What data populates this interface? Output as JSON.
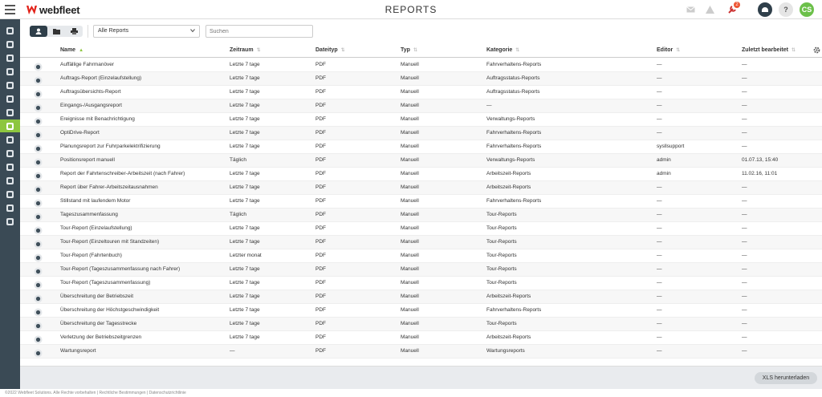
{
  "app": {
    "brand": "webfleet",
    "title": "REPORTS",
    "alert_count": "2",
    "avatar_initials": "CS",
    "help_label": "?"
  },
  "colors": {
    "brand_red": "#e2231a",
    "accent": "#8dc63f",
    "sidebar": "#3a4a55",
    "avatar": "#6cc04a",
    "dark_button": "#2f3f4a",
    "alert_icon": "#e53"
  },
  "topbar_icons": [
    "mail-icon",
    "warning-icon",
    "tools-icon",
    "share-icon",
    "help-icon",
    "avatar"
  ],
  "sidebar": {
    "items": [
      {
        "name": "map-icon",
        "active": false
      },
      {
        "name": "vehicle-icon",
        "active": false
      },
      {
        "name": "driver-icon",
        "active": false
      },
      {
        "name": "orders-icon",
        "active": false
      },
      {
        "name": "alerts-icon",
        "active": false
      },
      {
        "name": "tools-icon",
        "active": false
      },
      {
        "name": "chart-icon",
        "active": false
      },
      {
        "name": "reports-icon",
        "active": true
      },
      {
        "name": "fuel-icon",
        "active": false
      },
      {
        "name": "building-icon",
        "active": false
      },
      {
        "name": "location-icon",
        "active": false
      },
      {
        "name": "user-icon",
        "active": false
      },
      {
        "name": "integration-icon",
        "active": false
      },
      {
        "name": "settings-circle-icon",
        "active": false
      },
      {
        "name": "gear-icon",
        "active": false
      }
    ]
  },
  "toolbar": {
    "views": [
      "user-icon",
      "folder-icon",
      "printer-icon"
    ],
    "active_view": 0,
    "filter_value": "Alle Reports",
    "search_placeholder": "Suchen"
  },
  "table": {
    "columns": [
      "Name",
      "Zeitraum",
      "Dateityp",
      "Typ",
      "Kategorie",
      "Editor",
      "Zuletzt bearbeitet"
    ],
    "sorted_column": 0,
    "rows": [
      {
        "icon": "driving-icon",
        "name": "Auffällige Fahrmanöver",
        "zeitraum": "Letzte 7 tage",
        "dateityp": "PDF",
        "typ": "Manuell",
        "kategorie": "Fahrverhaltens-Reports",
        "editor": "—",
        "zuletzt": "—"
      },
      {
        "icon": "order-icon",
        "name": "Auftrags-Report (Einzelaufstellung)",
        "zeitraum": "Letzte 7 tage",
        "dateityp": "PDF",
        "typ": "Manuell",
        "kategorie": "Auftragsstatus-Reports",
        "editor": "—",
        "zuletzt": "—"
      },
      {
        "icon": "order-icon",
        "name": "Auftragsübersichts-Report",
        "zeitraum": "Letzte 7 tage",
        "dateityp": "PDF",
        "typ": "Manuell",
        "kategorie": "Auftragsstatus-Reports",
        "editor": "—",
        "zuletzt": "—"
      },
      {
        "icon": "inout-icon",
        "name": "Eingangs-/Ausgangsreport",
        "zeitraum": "Letzte 7 tage",
        "dateityp": "PDF",
        "typ": "Manuell",
        "kategorie": "—",
        "editor": "—",
        "zuletzt": "—"
      },
      {
        "icon": "warning-icon",
        "name": "Ereignisse mit Benachrichtigung",
        "zeitraum": "Letzte 7 tage",
        "dateityp": "PDF",
        "typ": "Manuell",
        "kategorie": "Verwaltungs-Reports",
        "editor": "—",
        "zuletzt": "—"
      },
      {
        "icon": "gauge-icon",
        "name": "OptiDrive-Report",
        "zeitraum": "Letzte 7 tage",
        "dateityp": "PDF",
        "typ": "Manuell",
        "kategorie": "Fahrverhaltens-Reports",
        "editor": "—",
        "zuletzt": "—"
      },
      {
        "icon": "steering-icon",
        "name": "Planungsreport zur Fuhrparkelektrifizierung",
        "zeitraum": "Letzte 7 tage",
        "dateityp": "PDF",
        "typ": "Manuell",
        "kategorie": "Fahrverhaltens-Reports",
        "editor": "sysllsupport",
        "zuletzt": "—"
      },
      {
        "icon": "position-icon",
        "name": "Positionsreport manuell",
        "zeitraum": "Täglich",
        "dateityp": "PDF",
        "typ": "Manuell",
        "kategorie": "Verwaltungs-Reports",
        "editor": "admin",
        "zuletzt": "01.07.13, 15:40"
      },
      {
        "icon": "driver-icon",
        "name": "Report der Fahrtenschreiber-Arbeitszeit (nach Fahrer)",
        "zeitraum": "Letzte 7 tage",
        "dateityp": "PDF",
        "typ": "Manuell",
        "kategorie": "Arbeitszeit-Reports",
        "editor": "admin",
        "zuletzt": "11.02.16, 11:01"
      },
      {
        "icon": "exclamation-icon",
        "name": "Report über Fahrer-Arbeitszeitausnahmen",
        "zeitraum": "Letzte 7 tage",
        "dateityp": "PDF",
        "typ": "Manuell",
        "kategorie": "Arbeitszeit-Reports",
        "editor": "—",
        "zuletzt": "—"
      },
      {
        "icon": "exclamation-icon",
        "name": "Stillstand mit laufendem Motor",
        "zeitraum": "Letzte 7 tage",
        "dateityp": "PDF",
        "typ": "Manuell",
        "kategorie": "Fahrverhaltens-Reports",
        "editor": "—",
        "zuletzt": "—"
      },
      {
        "icon": "chart-icon",
        "name": "Tageszusammenfassung",
        "zeitraum": "Täglich",
        "dateityp": "PDF",
        "typ": "Manuell",
        "kategorie": "Tour-Reports",
        "editor": "—",
        "zuletzt": "—"
      },
      {
        "icon": "tour-icon",
        "name": "Tour-Report (Einzelaufstellung)",
        "zeitraum": "Letzte 7 tage",
        "dateityp": "PDF",
        "typ": "Manuell",
        "kategorie": "Tour-Reports",
        "editor": "—",
        "zuletzt": "—"
      },
      {
        "icon": "tour-icon",
        "name": "Tour-Report (Einzeltouren mit Standzeiten)",
        "zeitraum": "Letzte 7 tage",
        "dateityp": "PDF",
        "typ": "Manuell",
        "kategorie": "Tour-Reports",
        "editor": "—",
        "zuletzt": "—"
      },
      {
        "icon": "truck-icon",
        "name": "Tour-Report (Fahrtenbuch)",
        "zeitraum": "Letzter monat",
        "dateityp": "PDF",
        "typ": "Manuell",
        "kategorie": "Tour-Reports",
        "editor": "—",
        "zuletzt": "—"
      },
      {
        "icon": "summary-icon",
        "name": "Tour-Report (Tageszusammenfassung nach Fahrer)",
        "zeitraum": "Letzte 7 tage",
        "dateityp": "PDF",
        "typ": "Manuell",
        "kategorie": "Tour-Reports",
        "editor": "—",
        "zuletzt": "—"
      },
      {
        "icon": "summary-icon",
        "name": "Tour-Report (Tageszusammenfassung)",
        "zeitraum": "Letzte 7 tage",
        "dateityp": "PDF",
        "typ": "Manuell",
        "kategorie": "Tour-Reports",
        "editor": "—",
        "zuletzt": "—"
      },
      {
        "icon": "clock-icon",
        "name": "Überschreitung der Betriebszeit",
        "zeitraum": "Letzte 7 tage",
        "dateityp": "PDF",
        "typ": "Manuell",
        "kategorie": "Arbeitszeit-Reports",
        "editor": "—",
        "zuletzt": "—"
      },
      {
        "icon": "speed-icon",
        "name": "Überschreitung der Höchstgeschwindigkeit",
        "zeitraum": "Letzte 7 tage",
        "dateityp": "PDF",
        "typ": "Manuell",
        "kategorie": "Fahrverhaltens-Reports",
        "editor": "—",
        "zuletzt": "—"
      },
      {
        "icon": "distance-icon",
        "name": "Überschreitung der Tagesstrecke",
        "zeitraum": "Letzte 7 tage",
        "dateityp": "PDF",
        "typ": "Manuell",
        "kategorie": "Tour-Reports",
        "editor": "—",
        "zuletzt": "—"
      },
      {
        "icon": "timer-icon",
        "name": "Verletzung der Betriebszeitgrenzen",
        "zeitraum": "Letzte 7 tage",
        "dateityp": "PDF",
        "typ": "Manuell",
        "kategorie": "Arbeitszeit-Reports",
        "editor": "—",
        "zuletzt": "—"
      },
      {
        "icon": "wrench-icon",
        "name": "Wartungsreport",
        "zeitraum": "—",
        "dateityp": "PDF",
        "typ": "Manuell",
        "kategorie": "Wartungsreports",
        "editor": "—",
        "zuletzt": "—"
      }
    ]
  },
  "actions": {
    "xls_label": "XLS herunterladen"
  },
  "footer": {
    "text": "©2022 Webfleet Solutions. Alle Rechte vorbehalten | Rechtliche Bestimmungen | Datenschutzrichtlinie"
  }
}
